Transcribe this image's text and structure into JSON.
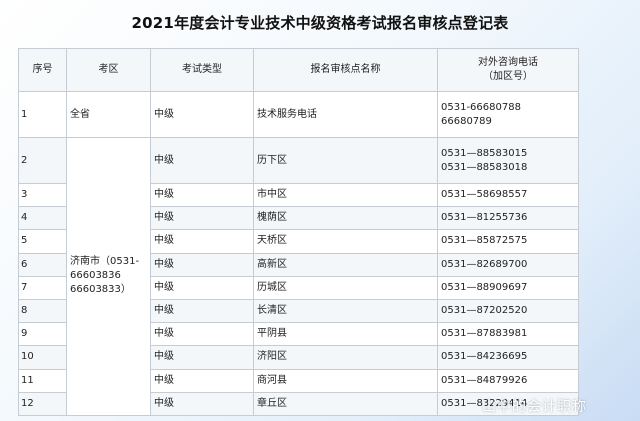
{
  "title": "2021年度会计专业技术中级资格考试报名审核点登记表",
  "table": {
    "headers": {
      "seq": "序号",
      "area": "考区",
      "type": "考试类型",
      "site": "报名审核点名称",
      "phone_line1": "对外咨询电话",
      "phone_line2": "（加区号）"
    },
    "row_quansheng": {
      "seq": "1",
      "area": "全省",
      "type": "中级",
      "site": "技术服务电话",
      "phone_line1": "0531-66680788",
      "phone_line2": "66680789"
    },
    "jinan_area": {
      "line1": "济南市（0531-",
      "line2": "66603836",
      "line3": "66603833）"
    },
    "rows": [
      {
        "seq": "2",
        "type": "中级",
        "site": "历下区",
        "phone_line1": "0531—88583015",
        "phone_line2": "0531—88583018"
      },
      {
        "seq": "3",
        "type": "中级",
        "site": "市中区",
        "phone": "0531—58698557"
      },
      {
        "seq": "4",
        "type": "中级",
        "site": "槐荫区",
        "phone": "0531—81255736"
      },
      {
        "seq": "5",
        "type": "中级",
        "site": "天桥区",
        "phone": "0531—85872575"
      },
      {
        "seq": "6",
        "type": "中级",
        "site": "高新区",
        "phone": "0531—82689700"
      },
      {
        "seq": "7",
        "type": "中级",
        "site": "历城区",
        "phone": "0531—88909697"
      },
      {
        "seq": "8",
        "type": "中级",
        "site": "长清区",
        "phone": "0531—87202520"
      },
      {
        "seq": "9",
        "type": "中级",
        "site": "平阴县",
        "phone": "0531—87883981"
      },
      {
        "seq": "10",
        "type": "中级",
        "site": "济阳区",
        "phone": "0531—84236695"
      },
      {
        "seq": "11",
        "type": "中级",
        "site": "商河县",
        "phone": "0531—84879926"
      },
      {
        "seq": "12",
        "type": "中级",
        "site": "章丘区",
        "phone": "0531—83229414"
      }
    ]
  },
  "watermark": "山中的会计职称"
}
